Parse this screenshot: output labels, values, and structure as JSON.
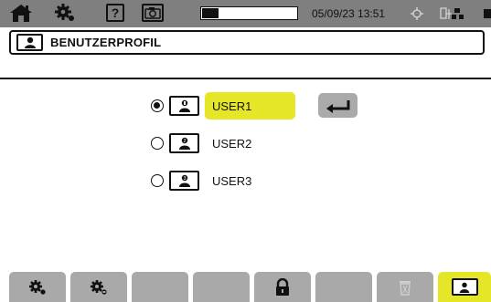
{
  "status_bar": {
    "datetime": "05/09/23 13:51",
    "progress_fraction": 0.17,
    "icons": [
      "home-icon",
      "settings-gear-icon",
      "help-icon",
      "camera-icon",
      "gps-icon",
      "usb-icon",
      "network-icon",
      "battery-icon"
    ]
  },
  "title": {
    "text": "BENUTZERPROFIL",
    "icon": "user-profile-icon"
  },
  "users": [
    {
      "label": "USER1",
      "selected": true
    },
    {
      "label": "USER2",
      "selected": false
    },
    {
      "label": "USER3",
      "selected": false
    }
  ],
  "enter_button": {
    "icon": "enter-return-icon"
  },
  "function_keys": [
    {
      "icon": "gear-icon",
      "active": false
    },
    {
      "icon": "gear-alt-icon",
      "active": false
    },
    {
      "icon": "",
      "active": false
    },
    {
      "icon": "",
      "active": false
    },
    {
      "icon": "lock-icon",
      "active": false
    },
    {
      "icon": "",
      "active": false
    },
    {
      "icon": "trash-icon",
      "active": false
    },
    {
      "icon": "user-profile-icon",
      "active": true
    }
  ],
  "colors": {
    "status_bar_bg": "#7f7f7f",
    "highlight": "#e6e628",
    "function_key_bg": "#a9a9a9"
  }
}
